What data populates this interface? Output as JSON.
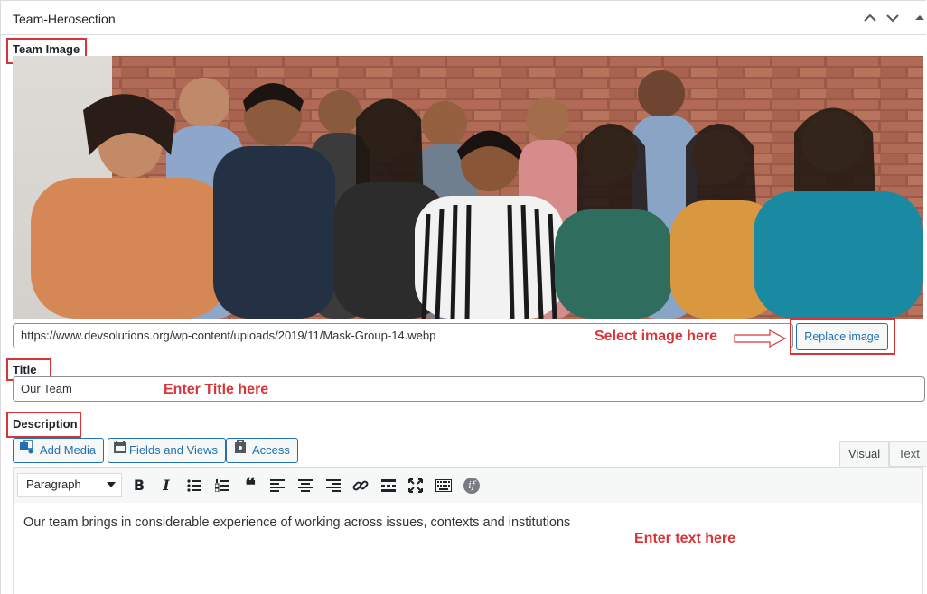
{
  "panel": {
    "title": "Team-Herosection",
    "controls": [
      "chevron-up-icon",
      "chevron-down-icon",
      "triangle-up-icon"
    ]
  },
  "team_image": {
    "label": "Team Image",
    "url_value": "https://www.devsolutions.org/wp-content/uploads/2019/11/Mask-Group-14.webp",
    "replace_button": "Replace image",
    "annotation": "Select image here"
  },
  "title_field": {
    "label": "Title",
    "value": "Our Team",
    "annotation": "Enter Title here"
  },
  "description": {
    "label": "Description",
    "buttons": {
      "add_media": "Add Media",
      "fields_views": "Fields and Views",
      "access": "Access"
    },
    "tabs": {
      "visual": "Visual",
      "text": "Text"
    },
    "format_select": "Paragraph",
    "toolbar_icons": [
      "bold-icon",
      "italic-icon",
      "bullet-list-icon",
      "numbered-list-icon",
      "blockquote-icon",
      "align-left-icon",
      "align-center-icon",
      "align-right-icon",
      "link-icon",
      "read-more-icon",
      "fullscreen-icon",
      "toolbar-toggle-icon",
      "conditional-if-icon"
    ],
    "toolbar_glyphs": {
      "bold": "B",
      "italic": "I",
      "quote": "❝",
      "if": "if"
    },
    "content": "Our team brings in considerable experience of working across issues, contexts and institutions",
    "annotation": "Enter text here"
  },
  "colors": {
    "annotation_red": "#d63638",
    "wp_blue": "#2271b1",
    "border": "#dcdcde",
    "toolbar_bg": "#f6f7f7"
  }
}
